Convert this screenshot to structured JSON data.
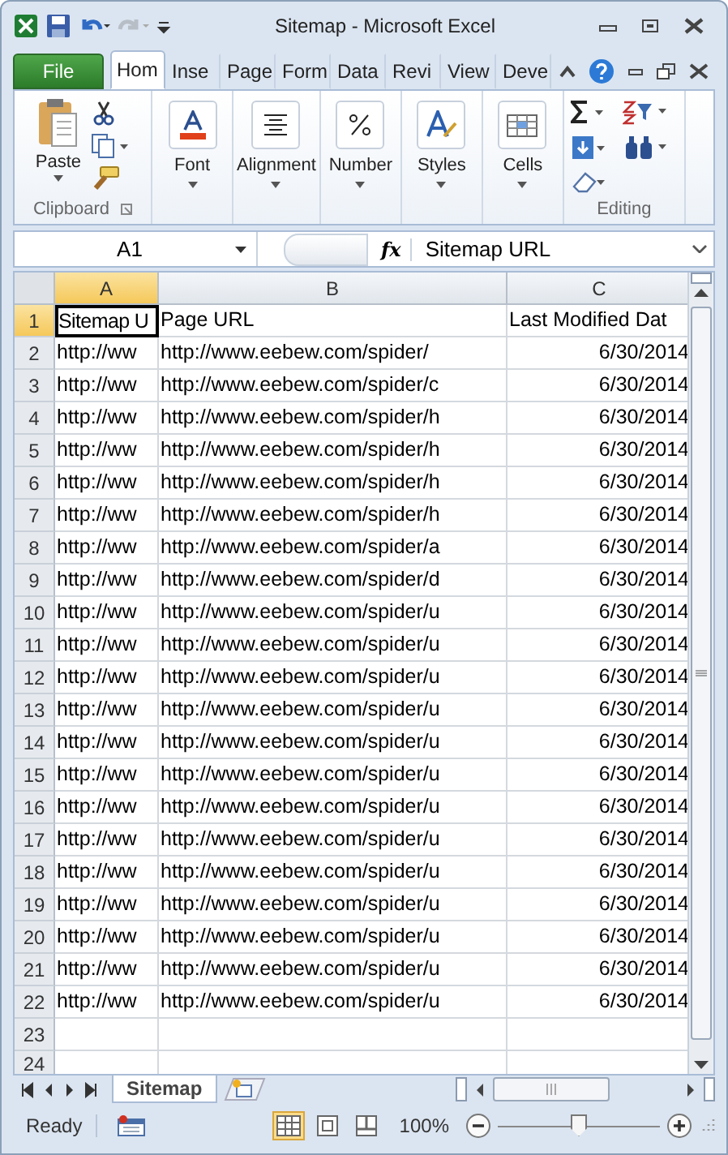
{
  "window": {
    "title": "Sitemap  -  Microsoft Excel"
  },
  "tabs": [
    {
      "label": "File",
      "kind": "file",
      "selected": false
    },
    {
      "label": "Hom",
      "kind": "tab",
      "selected": true
    },
    {
      "label": "Inse",
      "kind": "tab",
      "selected": false
    },
    {
      "label": "Page",
      "kind": "tab",
      "selected": false
    },
    {
      "label": "Form",
      "kind": "tab",
      "selected": false
    },
    {
      "label": "Data",
      "kind": "tab",
      "selected": false
    },
    {
      "label": "Revi",
      "kind": "tab",
      "selected": false
    },
    {
      "label": "View",
      "kind": "tab",
      "selected": false
    },
    {
      "label": "Deve",
      "kind": "tab",
      "selected": false
    }
  ],
  "ribbon": {
    "clipboard": {
      "paste": "Paste",
      "label": "Clipboard"
    },
    "groups": [
      {
        "label": "Font",
        "kind": "font"
      },
      {
        "label": "Alignment",
        "kind": "align"
      },
      {
        "label": "Number",
        "kind": "number"
      },
      {
        "label": "Styles",
        "kind": "styles"
      },
      {
        "label": "Cells",
        "kind": "cells"
      }
    ],
    "editing": {
      "label": "Editing"
    }
  },
  "formula_bar": {
    "name_box": "A1",
    "function_label": "fx",
    "value": "Sitemap URL"
  },
  "sheet": {
    "columns": [
      {
        "label": "A",
        "selected": true
      },
      {
        "label": "B",
        "selected": false
      },
      {
        "label": "C",
        "selected": false
      }
    ],
    "rows": [
      {
        "number": "1",
        "selected": true,
        "cells": [
          "Sitemap U",
          "Page URL",
          "Last Modified Dat"
        ]
      },
      {
        "number": "2",
        "selected": false,
        "cells": [
          "http://ww",
          "http://www.eebew.com/spider/",
          "6/30/2014"
        ]
      },
      {
        "number": "3",
        "selected": false,
        "cells": [
          "http://ww",
          "http://www.eebew.com/spider/c",
          "6/30/2014"
        ]
      },
      {
        "number": "4",
        "selected": false,
        "cells": [
          "http://ww",
          "http://www.eebew.com/spider/h",
          "6/30/2014"
        ]
      },
      {
        "number": "5",
        "selected": false,
        "cells": [
          "http://ww",
          "http://www.eebew.com/spider/h",
          "6/30/2014"
        ]
      },
      {
        "number": "6",
        "selected": false,
        "cells": [
          "http://ww",
          "http://www.eebew.com/spider/h",
          "6/30/2014"
        ]
      },
      {
        "number": "7",
        "selected": false,
        "cells": [
          "http://ww",
          "http://www.eebew.com/spider/h",
          "6/30/2014"
        ]
      },
      {
        "number": "8",
        "selected": false,
        "cells": [
          "http://ww",
          "http://www.eebew.com/spider/a",
          "6/30/2014"
        ]
      },
      {
        "number": "9",
        "selected": false,
        "cells": [
          "http://ww",
          "http://www.eebew.com/spider/d",
          "6/30/2014"
        ]
      },
      {
        "number": "10",
        "selected": false,
        "cells": [
          "http://ww",
          "http://www.eebew.com/spider/u",
          "6/30/2014"
        ]
      },
      {
        "number": "11",
        "selected": false,
        "cells": [
          "http://ww",
          "http://www.eebew.com/spider/u",
          "6/30/2014"
        ]
      },
      {
        "number": "12",
        "selected": false,
        "cells": [
          "http://ww",
          "http://www.eebew.com/spider/u",
          "6/30/2014"
        ]
      },
      {
        "number": "13",
        "selected": false,
        "cells": [
          "http://ww",
          "http://www.eebew.com/spider/u",
          "6/30/2014"
        ]
      },
      {
        "number": "14",
        "selected": false,
        "cells": [
          "http://ww",
          "http://www.eebew.com/spider/u",
          "6/30/2014"
        ]
      },
      {
        "number": "15",
        "selected": false,
        "cells": [
          "http://ww",
          "http://www.eebew.com/spider/u",
          "6/30/2014"
        ]
      },
      {
        "number": "16",
        "selected": false,
        "cells": [
          "http://ww",
          "http://www.eebew.com/spider/u",
          "6/30/2014"
        ]
      },
      {
        "number": "17",
        "selected": false,
        "cells": [
          "http://ww",
          "http://www.eebew.com/spider/u",
          "6/30/2014"
        ]
      },
      {
        "number": "18",
        "selected": false,
        "cells": [
          "http://ww",
          "http://www.eebew.com/spider/u",
          "6/30/2014"
        ]
      },
      {
        "number": "19",
        "selected": false,
        "cells": [
          "http://ww",
          "http://www.eebew.com/spider/u",
          "6/30/2014"
        ]
      },
      {
        "number": "20",
        "selected": false,
        "cells": [
          "http://ww",
          "http://www.eebew.com/spider/u",
          "6/30/2014"
        ]
      },
      {
        "number": "21",
        "selected": false,
        "cells": [
          "http://ww",
          "http://www.eebew.com/spider/u",
          "6/30/2014"
        ]
      },
      {
        "number": "22",
        "selected": false,
        "cells": [
          "http://ww",
          "http://www.eebew.com/spider/u",
          "6/30/2014"
        ]
      },
      {
        "number": "23",
        "selected": false,
        "cells": []
      },
      {
        "number": "24",
        "selected": false,
        "cells": []
      }
    ]
  },
  "sheet_tabs": [
    {
      "label": "Sitemap",
      "selected": true
    }
  ],
  "status_bar": {
    "status": "Ready",
    "zoom": "100%",
    "zoom_slider": {
      "level": 0.5
    }
  }
}
